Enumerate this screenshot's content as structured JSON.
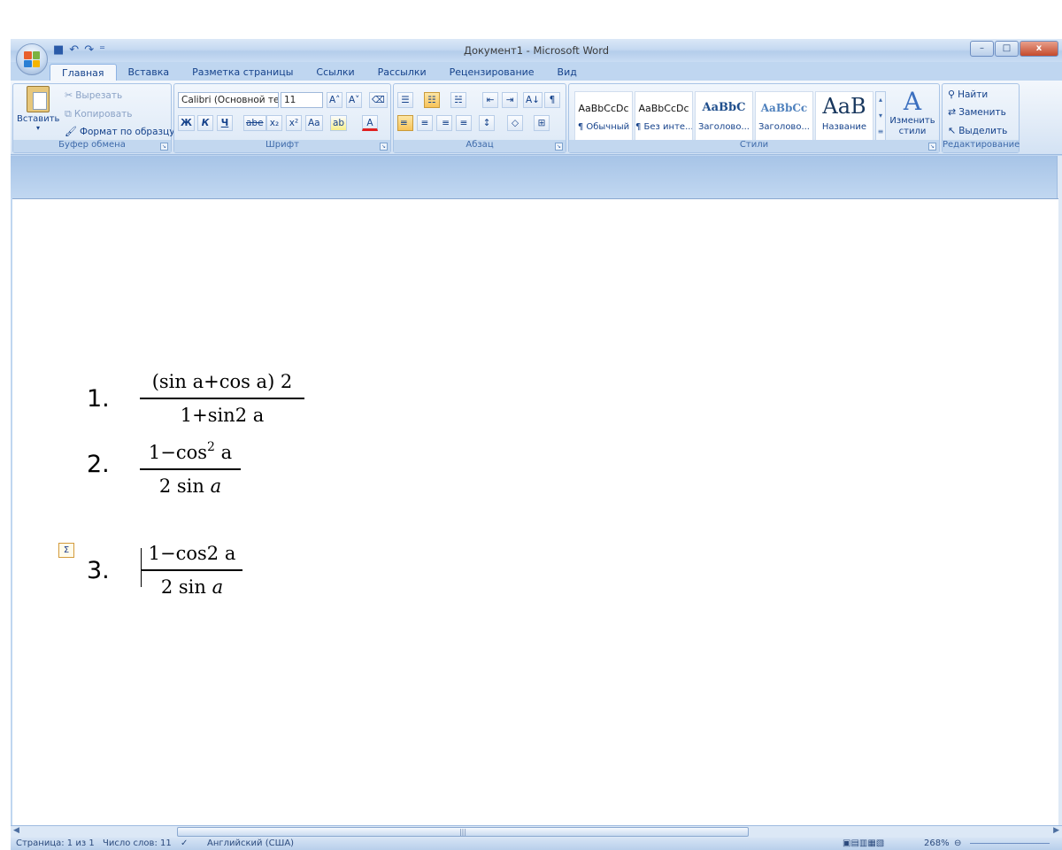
{
  "window": {
    "title": "Документ1 - Microsoft Word",
    "controls": {
      "minimize": "–",
      "maximize": "□",
      "close": "x"
    }
  },
  "qat": {
    "save": "■",
    "undo": "↶",
    "redo": "↷",
    "customize": "⁼"
  },
  "tabs": [
    {
      "label": "Главная",
      "active": true
    },
    {
      "label": "Вставка"
    },
    {
      "label": "Разметка страницы"
    },
    {
      "label": "Ссылки"
    },
    {
      "label": "Рассылки"
    },
    {
      "label": "Рецензирование"
    },
    {
      "label": "Вид"
    }
  ],
  "clipboard": {
    "label": "Буфер обмена",
    "paste": "Вставить",
    "cut": "Вырезать",
    "copy": "Копировать",
    "format_painter": "Формат по образцу"
  },
  "font": {
    "label": "Шрифт",
    "name": "Calibri (Основной те",
    "size": "11",
    "grow": "A˄",
    "shrink": "A˅",
    "clear": "⌫",
    "bold": "Ж",
    "italic": "К",
    "underline": "Ч",
    "strike": "abe",
    "subscript": "x₂",
    "superscript": "x²",
    "case": "Aa",
    "highlight": "ab",
    "color": "A"
  },
  "paragraph": {
    "label": "Абзац",
    "bullets": "☰",
    "numbering": "☷",
    "multilevel": "☵",
    "decrease_indent": "⇤",
    "increase_indent": "⇥",
    "sort": "A↓",
    "pilcrow": "¶",
    "align_left": "≡",
    "align_center": "≡",
    "align_right": "≡",
    "justify": "≡",
    "spacing": "↕",
    "shading": "◇",
    "borders": "⊞"
  },
  "styles": {
    "label": "Стили",
    "items": [
      {
        "preview": "AaBbCcDc",
        "name": "¶ Обычный"
      },
      {
        "preview": "AaBbCcDc",
        "name": "¶ Без инте..."
      },
      {
        "preview": "AaBbC",
        "name": "Заголово..."
      },
      {
        "preview": "AaBbCc",
        "name": "Заголово..."
      },
      {
        "preview": "AaB",
        "name": "Название"
      }
    ],
    "change": "Изменить стили"
  },
  "editing": {
    "label": "Редактирование",
    "find": "Найти",
    "replace": "Заменить",
    "select": "Выделить"
  },
  "document": {
    "items": [
      {
        "num": "1.",
        "numerator": "(sin a+cos a) 2",
        "denominator": "1+sin2 a"
      },
      {
        "num": "2.",
        "numerator_pre": "1−cos",
        "numerator_sup": "2",
        "numerator_post": " a",
        "den_pre": "2 sin ",
        "den_var": "a"
      },
      {
        "num": "3.",
        "numerator": "1−cos2 a",
        "den_pre": "2 sin ",
        "den_var": "a"
      }
    ]
  },
  "status": {
    "page": "Страница: 1 из 1",
    "words": "Число слов: 11",
    "language": "Английский (США)",
    "zoom": "268%"
  },
  "colors": {
    "accent": "#15428b",
    "ribbon": "#dce8f6",
    "page": "#ffffff"
  }
}
